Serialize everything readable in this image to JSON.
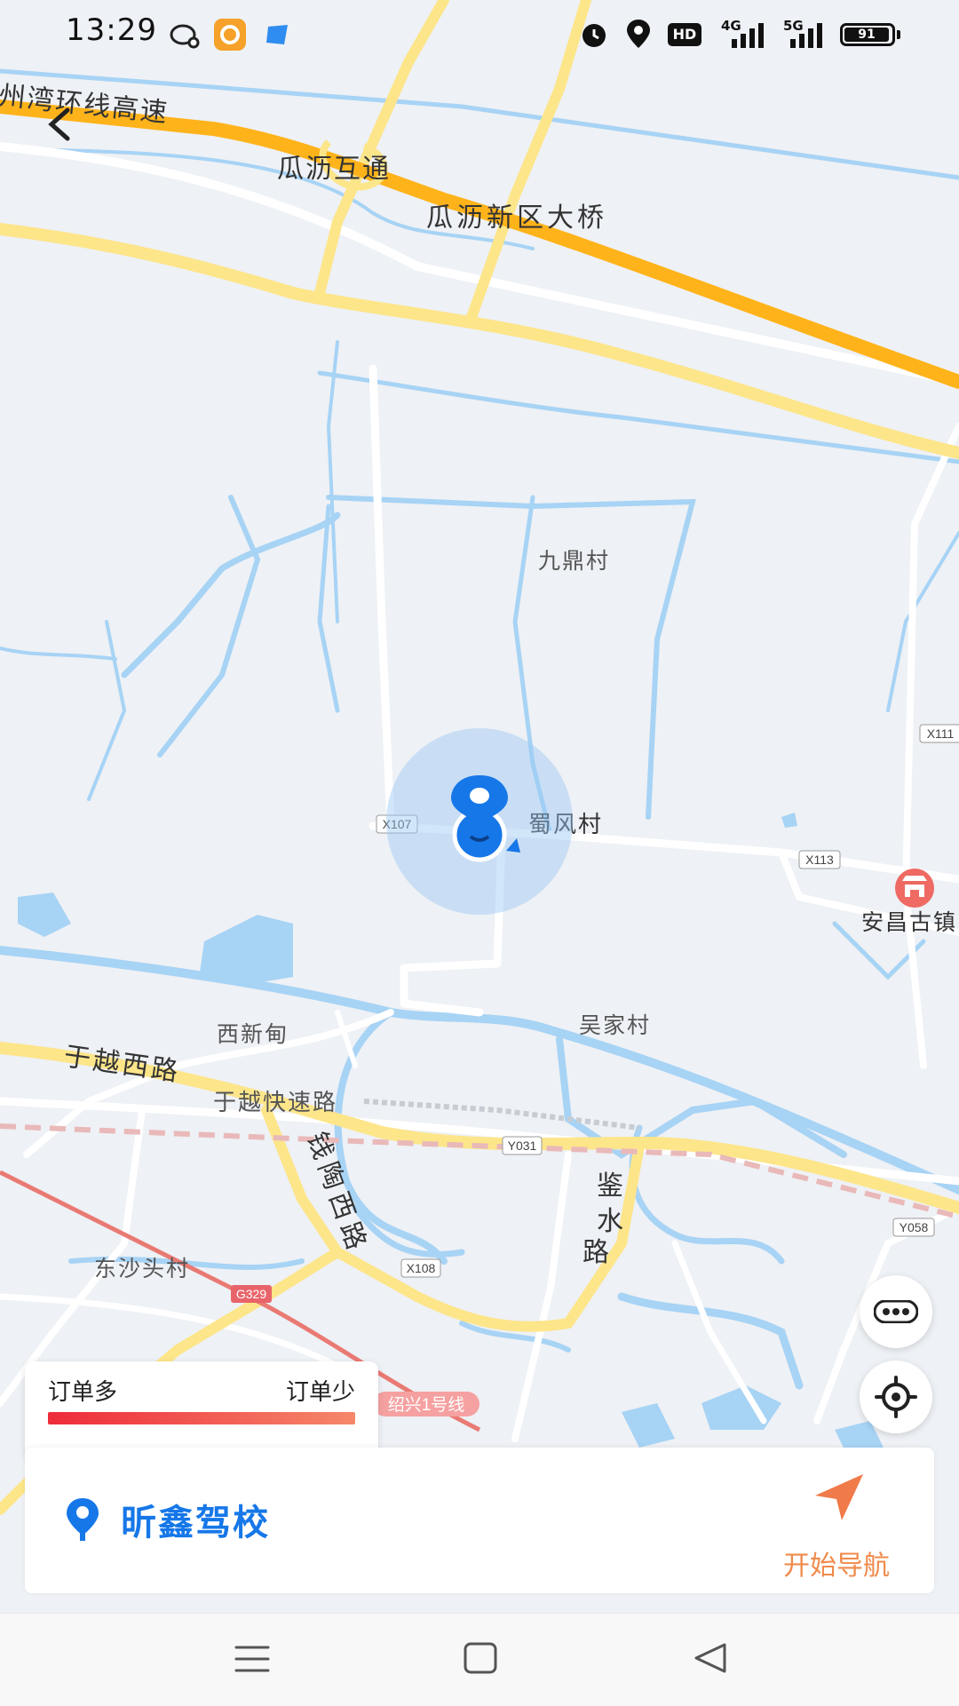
{
  "status_bar": {
    "time": "13:29",
    "battery": "91",
    "network_4g": "4G",
    "network_5g": "5G",
    "hd": "HD",
    "icons": [
      "chat-icon",
      "app-orange-icon",
      "app-blue-icon",
      "alarm-icon",
      "location-icon"
    ]
  },
  "map": {
    "road_labels": [
      "州湾环线高速",
      "瓜沥互通",
      "瓜沥新区大桥",
      "于越西路",
      "于越快速路",
      "钱陶西路",
      "鉴水路"
    ],
    "place_labels": [
      "九鼎村",
      "蜀风村",
      "吴家村",
      "西新甸",
      "东沙头村",
      "安昌古镇"
    ],
    "road_codes": [
      "X107",
      "X113",
      "X111",
      "Y031",
      "X108",
      "G329",
      "Y058"
    ],
    "metro_label": "绍兴1号线",
    "colors": {
      "water": "#a7d3f5",
      "highway": "#ffb31a",
      "main_road": "#fde58a",
      "land": "#eef1f5",
      "accent": "#1677e8"
    }
  },
  "legend": {
    "left": "订单多",
    "right": "订单少"
  },
  "location_card": {
    "name": "昕鑫驾校",
    "nav_label": "开始导航"
  },
  "side_buttons": {
    "more": "more-icon",
    "locate": "locate-icon"
  },
  "nav_bar": {
    "icons": [
      "menu-icon",
      "home-icon",
      "back-icon"
    ]
  }
}
